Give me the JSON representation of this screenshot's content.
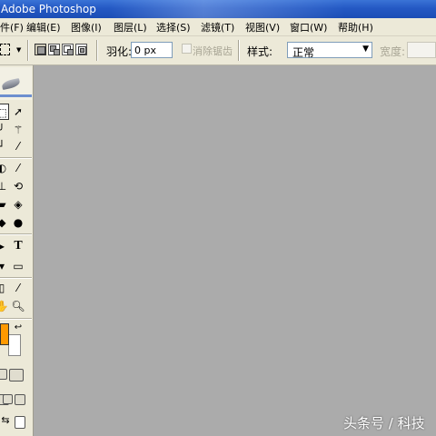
{
  "window": {
    "title": "Adobe Photoshop"
  },
  "menubar": {
    "items": [
      {
        "label": "件(F)"
      },
      {
        "label": "编辑(E)"
      },
      {
        "label": "图像(I)"
      },
      {
        "label": "图层(L)"
      },
      {
        "label": "选择(S)"
      },
      {
        "label": "滤镜(T)"
      },
      {
        "label": "视图(V)"
      },
      {
        "label": "窗口(W)"
      },
      {
        "label": "帮助(H)"
      }
    ]
  },
  "options": {
    "feather_label": "羽化:",
    "feather_value": "0 px",
    "antialias_label": "消除锯齿",
    "style_label": "样式:",
    "style_value": "正常",
    "width_label": "宽度:"
  },
  "toolbox": {
    "tools": [
      "rect-marquee-icon",
      "move-icon",
      "lasso-icon",
      "magic-wand-icon",
      "crop-icon",
      "slice-icon",
      "healing-brush-icon",
      "brush-icon",
      "clone-stamp-icon",
      "history-brush-icon",
      "eraser-icon",
      "paint-bucket-icon",
      "blur-icon",
      "dodge-icon",
      "path-select-icon",
      "type-icon",
      "pen-icon",
      "rectangle-shape-icon",
      "notes-icon",
      "eyedropper-icon",
      "hand-icon",
      "zoom-icon"
    ],
    "text_tool_glyph": "T",
    "foreground_color": "#ff9900",
    "background_color": "#ffffff"
  },
  "watermark": {
    "text": "头条号 / 科技"
  },
  "colors": {
    "titlebar": "#2459c4",
    "chrome": "#ece9d8",
    "workspace": "#ababab"
  }
}
